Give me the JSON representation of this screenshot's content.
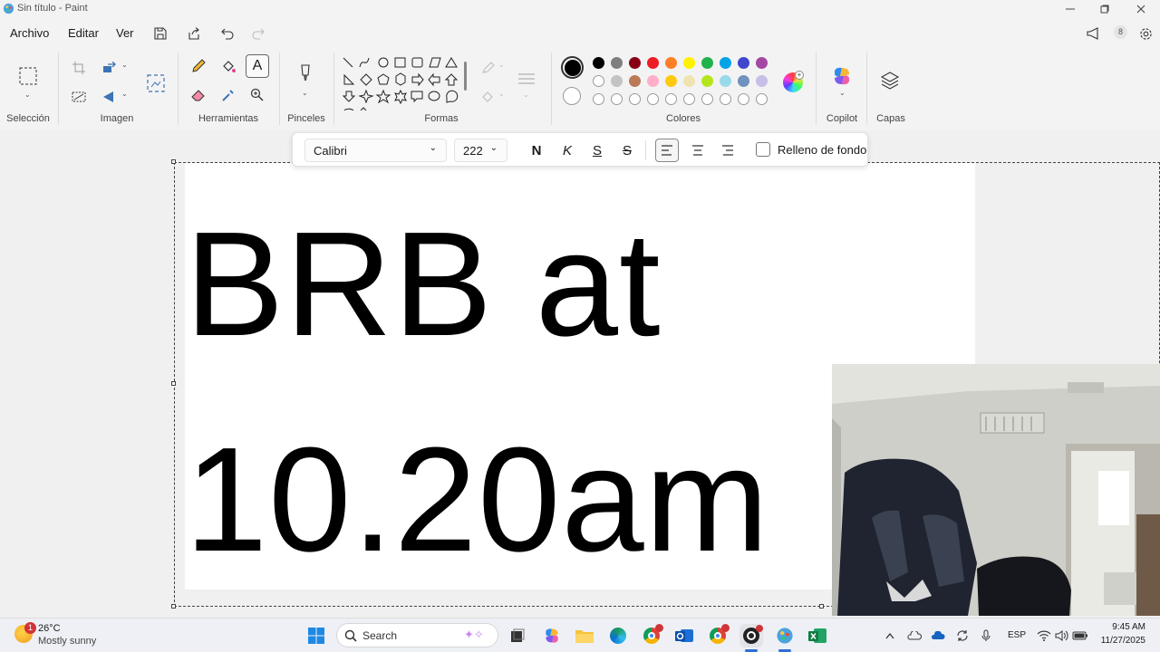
{
  "window": {
    "title": "Sin título - Paint"
  },
  "menu": {
    "file": "Archivo",
    "edit": "Editar",
    "view": "Ver"
  },
  "ribbon": {
    "groups": {
      "selection": "Selección",
      "image": "Imagen",
      "tools": "Herramientas",
      "brushes": "Pinceles",
      "shapes": "Formas",
      "colors": "Colores",
      "copilot": "Copilot",
      "layers": "Capas"
    },
    "active_color": "#000000",
    "palette_row1": [
      "#000000",
      "#7f7f7f",
      "#880015",
      "#ed1c24",
      "#ff7f27",
      "#fff200",
      "#22b14c",
      "#00a2e8",
      "#3f48cc",
      "#a349a4"
    ],
    "palette_row2": [
      "#ffffff",
      "#c3c3c3",
      "#b97a57",
      "#ffaec9",
      "#ffc90e",
      "#efe4b0",
      "#b5e61d",
      "#99d9ea",
      "#7092be",
      "#c8bfe7"
    ]
  },
  "textbar": {
    "font": "Calibri",
    "size": "222",
    "bold": "N",
    "italic": "K",
    "underline": "S",
    "strike": "S",
    "fill_label": "Relleno de fondo"
  },
  "canvas": {
    "line1": "BRB at",
    "line2": "10.20am"
  },
  "taskbar": {
    "weather_temp": "26°C",
    "weather_desc": "Mostly sunny",
    "weather_badge": "1",
    "search_placeholder": "Search",
    "language": "ESP",
    "time": "9:45 AM",
    "date": "11/27/2025"
  }
}
